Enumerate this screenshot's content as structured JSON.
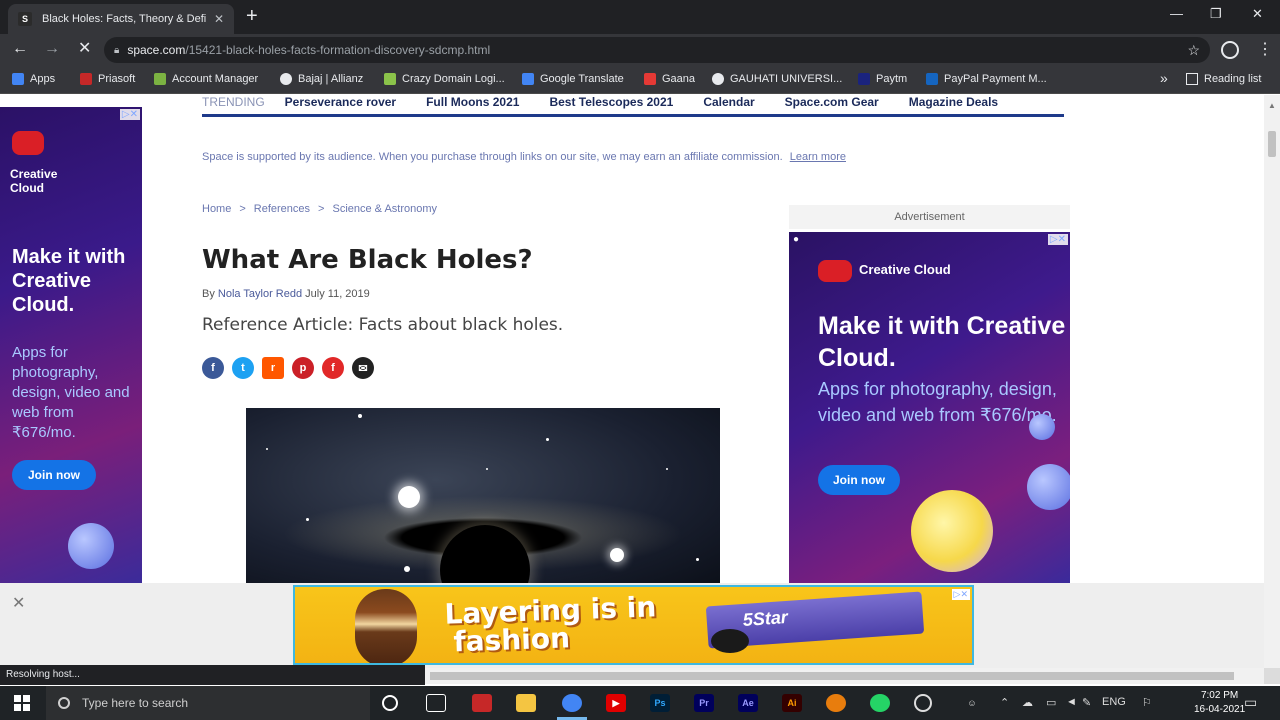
{
  "browser": {
    "tab_title": "Black Holes: Facts, Theory & Defi",
    "tab_favicon": "S",
    "url_host": "space.com",
    "url_path": "/15421-black-holes-facts-formation-discovery-sdcmp.html",
    "bookmarks": [
      {
        "label": "Apps",
        "color": "#4285f4"
      },
      {
        "label": "Priasoft",
        "color": "#c62828"
      },
      {
        "label": "Account Manager",
        "color": "#7cb342"
      },
      {
        "label": "Bajaj | Allianz",
        "color": "#e8eaed"
      },
      {
        "label": "Crazy Domain Logi...",
        "color": "#8bc34a"
      },
      {
        "label": "Google Translate",
        "color": "#4285f4"
      },
      {
        "label": "Gaana",
        "color": "#e53935"
      },
      {
        "label": "GAUHATI UNIVERSI...",
        "color": "#e8eaed"
      },
      {
        "label": "Paytm",
        "color": "#1a237e"
      },
      {
        "label": "PayPal Payment M...",
        "color": "#1565c0"
      }
    ],
    "bookmarks_more": "»",
    "reading_list": "Reading list",
    "status_text": "Resolving host..."
  },
  "page": {
    "trending_label": "TRENDING",
    "trending_items": [
      "Perseverance rover",
      "Full Moons 2021",
      "Best Telescopes 2021",
      "Calendar",
      "Space.com Gear",
      "Magazine Deals"
    ],
    "affiliate_text": "Space is supported by its audience. When you purchase through links on our site, we may earn an affiliate commission.",
    "affiliate_link": "Learn more",
    "breadcrumbs": [
      "Home",
      "References",
      "Science & Astronomy"
    ],
    "breadcrumb_sep": ">",
    "title": "What Are Black Holes?",
    "byline_prefix": "By",
    "author": "Nola Taylor Redd",
    "date": "July 11, 2019",
    "summary": "Reference Article: Facts about black holes.",
    "share_icons": [
      {
        "name": "facebook-icon",
        "glyph": "f",
        "color": "#3b5998"
      },
      {
        "name": "twitter-icon",
        "glyph": "t",
        "color": "#1da1f2"
      },
      {
        "name": "reddit-icon",
        "glyph": "r",
        "color": "#ff5700"
      },
      {
        "name": "pinterest-icon",
        "glyph": "p",
        "color": "#cb2027"
      },
      {
        "name": "flipboard-icon",
        "glyph": "f",
        "color": "#e12828"
      },
      {
        "name": "email-icon",
        "glyph": "✉",
        "color": "#222222"
      }
    ]
  },
  "ads": {
    "advertisement_label": "Advertisement",
    "left_ad": {
      "brand": "Creative Cloud",
      "headline": "Make it with Creative Cloud.",
      "body": "Apps for photography, design, video and web from ₹676/mo.",
      "cta": "Join now"
    },
    "right_ad": {
      "brand": "Creative Cloud",
      "headline": "Make it with Creative Cloud.",
      "body": "Apps for photography, design, video and web from ₹676/mo.",
      "cta": "Join now"
    },
    "bottom_ad": {
      "line1": "Layering is in",
      "line2": "fashion",
      "product": "5Star"
    },
    "ad_choices": "▷✕",
    "close_glyph": "✕"
  },
  "taskbar": {
    "search_placeholder": "Type here to search",
    "language": "ENG",
    "time": "7:02 PM",
    "date": "16-04-2021"
  }
}
